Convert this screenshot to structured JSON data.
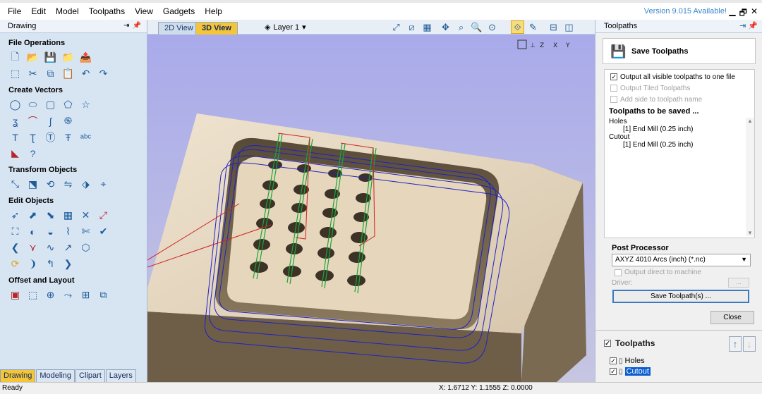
{
  "menu": [
    "File",
    "Edit",
    "Model",
    "Toolpaths",
    "View",
    "Gadgets",
    "Help"
  ],
  "version": "Version 9.015 Available!",
  "window_controls": [
    "▁",
    "🗗",
    "✕"
  ],
  "left_panel": {
    "title": "Drawing",
    "sections": [
      {
        "title": "File Operations"
      },
      {
        "title": "Create Vectors"
      },
      {
        "title": "Transform Objects"
      },
      {
        "title": "Edit Objects"
      },
      {
        "title": "Offset and Layout"
      }
    ],
    "tabs": [
      "Drawing",
      "Modeling",
      "Clipart",
      "Layers"
    ],
    "active_tab": "Drawing"
  },
  "view_tabs": {
    "tab_2d": "2D View",
    "tab_3d": "3D View"
  },
  "layer": "Layer 1",
  "right_panel": {
    "title": "Toolpaths",
    "save_title": "Save Toolpaths",
    "output_all": "Output all visible toolpaths to one file",
    "output_tiled": "Output Tiled Toolpaths",
    "add_side": "Add side to toolpath name",
    "to_be_saved": "Toolpaths to be saved ...",
    "groups": [
      {
        "name": "Holes",
        "item": "[1] End Mill (0.25 inch)"
      },
      {
        "name": "Cutout",
        "item": "[1] End Mill (0.25 inch)"
      }
    ],
    "post_processor_label": "Post Processor",
    "post_processor": "AXYZ 4010 Arcs (inch) (*.nc)",
    "output_direct": "Output direct to machine",
    "driver_label": "Driver:",
    "driver_btn": "...",
    "save_button": "Save Toolpath(s) ...",
    "close_button": "Close",
    "toolpaths_header": "Toolpaths",
    "items": [
      {
        "name": "Holes",
        "checked": true,
        "selected": false
      },
      {
        "name": "Cutout",
        "checked": true,
        "selected": true
      }
    ]
  },
  "status": {
    "ready": "Ready",
    "coords": "X: 1.6712 Y: 1.1555 Z: 0.0000"
  },
  "colors": {
    "accent_tab": "#f4c53a",
    "selection": "#0a5ccf",
    "viewport_bg": "#b7b8e7",
    "wood": "#e7d8c0"
  }
}
